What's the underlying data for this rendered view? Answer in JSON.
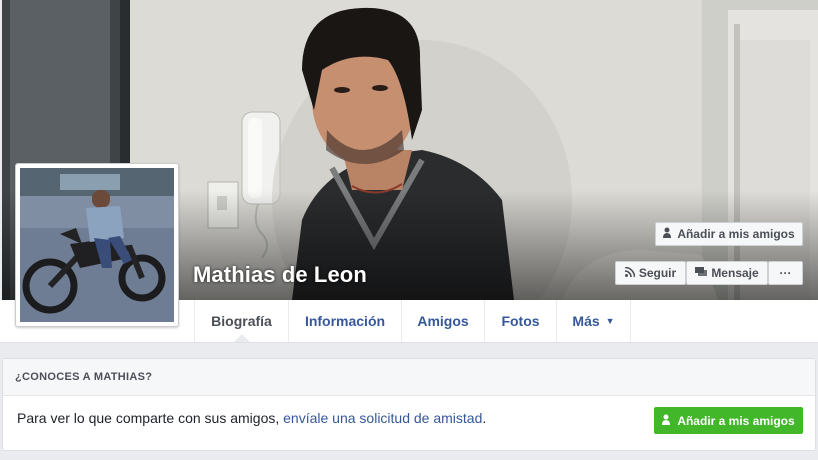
{
  "profile": {
    "name": "Mathias de Leon"
  },
  "cover_actions": {
    "add_friend": "Añadir a mis amigos",
    "follow": "Seguir",
    "message": "Mensaje",
    "more": "···"
  },
  "icons": {
    "add_friend": "add-friend-icon",
    "follow": "rss-icon",
    "message": "message-icon",
    "more_caret": "caret-down-icon"
  },
  "nav": {
    "tabs": [
      {
        "label": "Biografía"
      },
      {
        "label": "Información"
      },
      {
        "label": "Amigos"
      },
      {
        "label": "Fotos"
      },
      {
        "label": "Más"
      }
    ]
  },
  "friend_card": {
    "header": "¿CONOCES A MATHIAS?",
    "text_prefix": "Para ver lo que comparte con sus amigos, ",
    "link_text": "envíale una solicitud de amistad",
    "text_suffix": ".",
    "button_label": "Añadir a mis amigos"
  },
  "colors": {
    "link": "#365899",
    "green_button": "#42b72a",
    "page_bg": "#e9ebee"
  }
}
